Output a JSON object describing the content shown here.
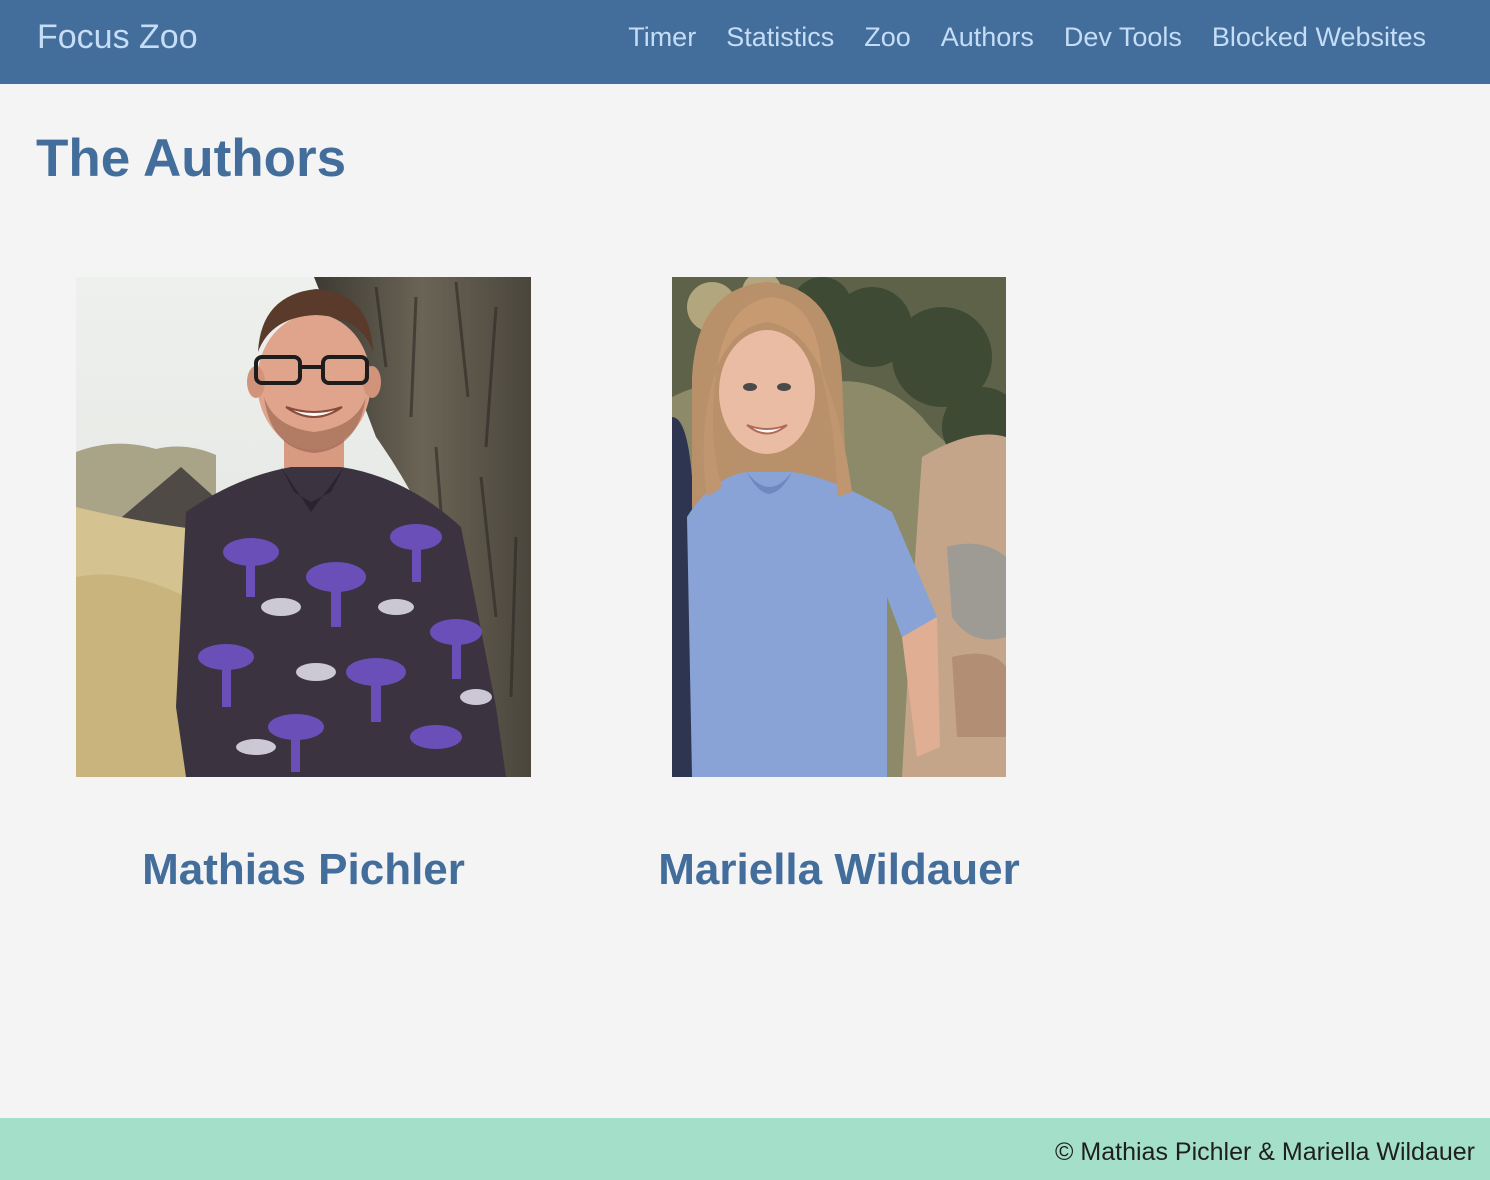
{
  "app": {
    "brand": "Focus Zoo"
  },
  "nav": {
    "items": [
      {
        "label": "Timer"
      },
      {
        "label": "Statistics"
      },
      {
        "label": "Zoo"
      },
      {
        "label": "Authors"
      },
      {
        "label": "Dev Tools"
      },
      {
        "label": "Blocked Websites"
      }
    ]
  },
  "page": {
    "title": "The Authors"
  },
  "authors": [
    {
      "name": "Mathias Pichler"
    },
    {
      "name": "Mariella Wildauer"
    }
  ],
  "footer": {
    "copyright": "© Mathias Pichler & Mariella Wildauer"
  },
  "colors": {
    "navbar": "#436d9b",
    "nav_text": "#c5ddf6",
    "heading": "#436d9b",
    "background": "#f4f4f4",
    "footer": "#a4dfca"
  }
}
